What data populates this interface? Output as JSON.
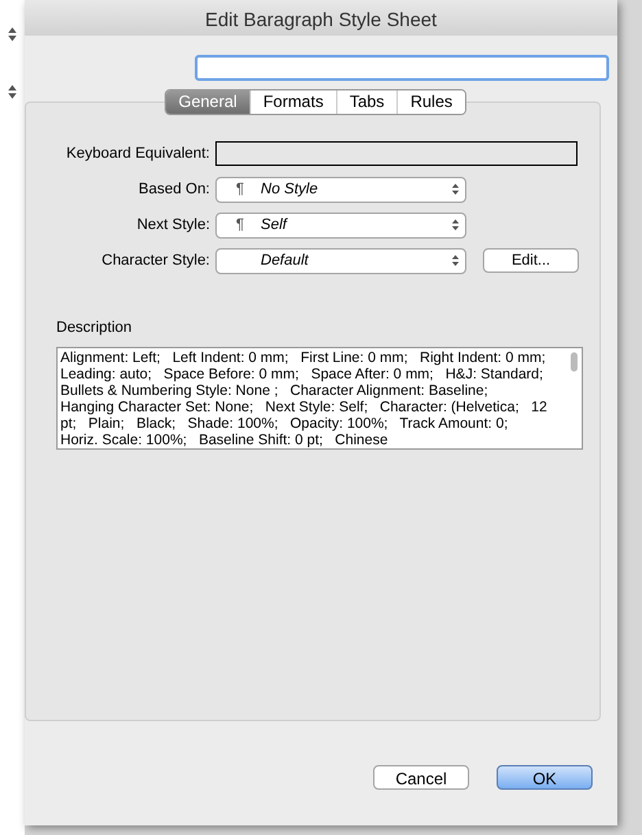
{
  "window": {
    "title": "Edit Baragraph Style Sheet"
  },
  "name_field": {
    "focused": true
  },
  "tabs": [
    {
      "label": "General",
      "selected": true
    },
    {
      "label": "Formats",
      "selected": false
    },
    {
      "label": "Tabs",
      "selected": false
    },
    {
      "label": "Rules",
      "selected": false
    }
  ],
  "keyboard_equivalent": {
    "label": "Keyboard Equivalent:"
  },
  "popups": [
    {
      "label": "Based On:",
      "value": "No Style",
      "icon": "¶"
    },
    {
      "label": "Next Style:",
      "value": "Self",
      "icon": "¶"
    },
    {
      "label": "Character Style:",
      "value": "Default",
      "button": "Edit..."
    }
  ],
  "description": {
    "heading": "Description",
    "text": "Alignment: Left;   Left Indent: 0 mm;   First Line: 0 mm;   Right Indent: 0 mm;   Leading: auto;   Space Before: 0 mm;   Space After: 0 mm;   H&J: Standard;   Bullets & Numbering Style: None ;   Character Alignment: Baseline;   Hanging Character Set: None;   Next Style: Self;   Character: (Helvetica;   12 pt;   Plain;   Black;   Shade: 100%;   Opacity: 100%;   Track Amount: 0;   Horiz. Scale: 100%;   Baseline Shift: 0 pt;   Chinese"
  },
  "buttons": [
    {
      "label": "Cancel",
      "default": false
    },
    {
      "label": "OK",
      "default": true
    }
  ]
}
